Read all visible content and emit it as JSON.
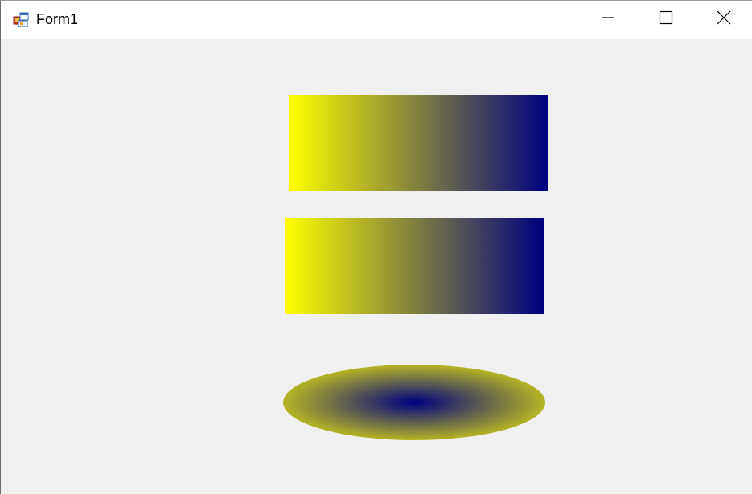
{
  "window": {
    "title": "Form1",
    "icon": "winforms-app-icon"
  },
  "caption_buttons": {
    "minimize": "minimize-icon",
    "maximize": "maximize-icon",
    "close": "close-icon"
  },
  "colors": {
    "gradient_start": "#ffff00",
    "gradient_end": "#000080",
    "client_background": "#f0f0f0",
    "title_bar_background": "#ffffff"
  },
  "shapes": [
    {
      "kind": "rectangle",
      "fill": "linear-gradient",
      "from": "#ffff00",
      "to": "#000080",
      "direction": "left-to-right"
    },
    {
      "kind": "rectangle",
      "fill": "linear-gradient",
      "from": "#ffff00",
      "to": "#000080",
      "direction": "left-to-right"
    },
    {
      "kind": "ellipse",
      "fill": "radial-gradient",
      "center": "#000080",
      "edge": "#ffff00"
    }
  ]
}
